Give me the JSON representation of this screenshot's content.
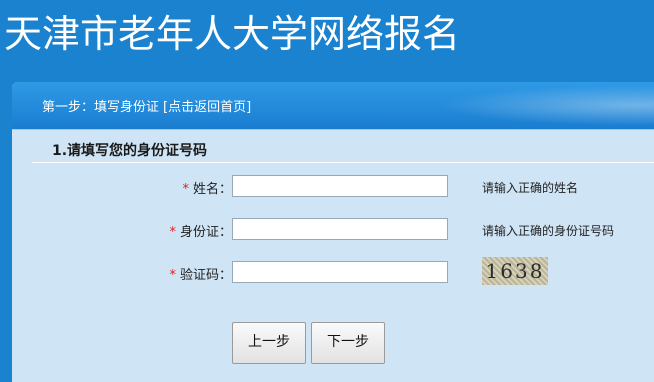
{
  "site": {
    "title": "天津市老年人大学网络报名"
  },
  "header": {
    "step_text": "第一步：填写身份证",
    "home_link": "[点击返回首页]"
  },
  "section": {
    "title": "1.请填写您的身份证号码"
  },
  "form": {
    "name": {
      "required_mark": "*",
      "label": "姓名：",
      "value": "",
      "hint": "请输入正确的姓名"
    },
    "id_card": {
      "required_mark": "*",
      "label": "身份证：",
      "value": "",
      "hint": "请输入正确的身份证号码"
    },
    "captcha": {
      "required_mark": "*",
      "label": "验证码：",
      "value": "",
      "image_text": "1638"
    }
  },
  "buttons": {
    "prev": "上一步",
    "next": "下一步"
  }
}
